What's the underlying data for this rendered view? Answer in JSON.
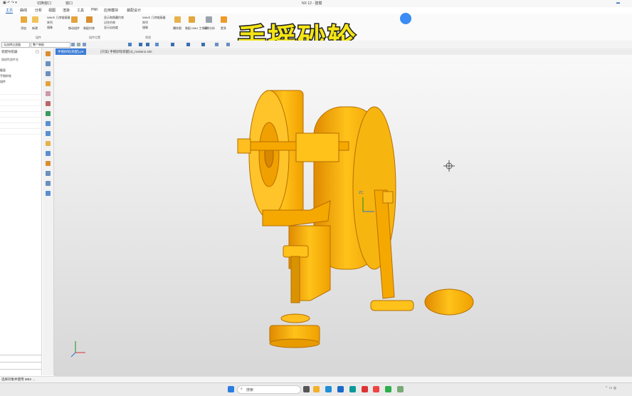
{
  "window": {
    "title": "NX 12 - 建模",
    "quick_save": "保存",
    "doc_switch": "切换窗口",
    "window_menu": "窗口"
  },
  "overlay_title": "手摇砂轮",
  "ribbon_tabs": [
    "主页",
    "曲线",
    "分析",
    "视图",
    "渲染",
    "工具",
    "PMI",
    "应用模块",
    "装配设计"
  ],
  "ribbon": {
    "group_labels": [
      "组件",
      "组件位置",
      "常规"
    ],
    "buttons": [
      "添加",
      "新建",
      "移动组件",
      "装配约束",
      "显示和隐藏约束",
      "记住约束",
      "显示自由度",
      "WAVE 几何链接器",
      "阵列",
      "镜像",
      "爆炸图",
      "装配 DMU 工作表",
      "间隙分析",
      "更多"
    ]
  },
  "toolbar": {
    "filter_select": "整个装配",
    "type_select": "无选择过滤器"
  },
  "left_panel": {
    "header": "装配导航器",
    "col_header": "描述性部件名",
    "items": [
      "截面",
      "手摇砂轮",
      "组件"
    ]
  },
  "doc_tabs": [
    "手摇砂轮(装配).prt",
    "(只读) 手摇砂轮装配(4)_motion1.sim"
  ],
  "viewport": {
    "axis_label": "ZC"
  },
  "status_bar": {
    "message": "选择对象并使用 MB3 …"
  },
  "taskbar": {
    "search_placeholder": "搜索"
  },
  "colors": {
    "model": "#f5a800",
    "accent": "#1a5fb4"
  }
}
